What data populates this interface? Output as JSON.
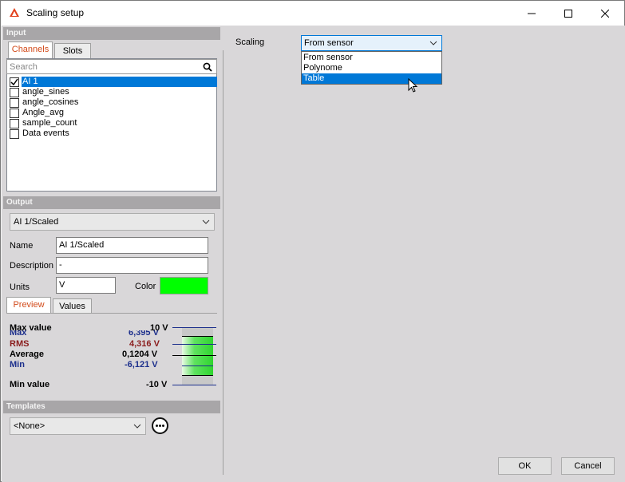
{
  "window": {
    "title": "Scaling setup"
  },
  "input": {
    "header": "Input",
    "tabs": [
      {
        "label": "Channels"
      },
      {
        "label": "Slots"
      }
    ],
    "search_placeholder": "Search",
    "channels": [
      {
        "label": "AI 1",
        "checked": true,
        "selected": true
      },
      {
        "label": "angle_sines",
        "checked": false,
        "selected": false
      },
      {
        "label": "angle_cosines",
        "checked": false,
        "selected": false
      },
      {
        "label": "Angle_avg",
        "checked": false,
        "selected": false
      },
      {
        "label": "sample_count",
        "checked": false,
        "selected": false
      },
      {
        "label": "Data events",
        "checked": false,
        "selected": false
      }
    ]
  },
  "output": {
    "header": "Output",
    "selected_channel": "AI 1/Scaled",
    "name_label": "Name",
    "name_value": "AI 1/Scaled",
    "description_label": "Description",
    "description_value": "-",
    "units_label": "Units",
    "units_value": "V",
    "color_label": "Color",
    "color_value": "#00ff00",
    "tabs": [
      {
        "label": "Preview"
      },
      {
        "label": "Values"
      }
    ],
    "preview": {
      "max_value_label": "Max value",
      "max_value": "10 V",
      "max_label": "Max",
      "max": "6,395 V",
      "rms_label": "RMS",
      "rms": "4,316 V",
      "average_label": "Average",
      "average": "0,1204 V",
      "min_label": "Min",
      "min": "-6,121 V",
      "min_value_label": "Min value",
      "min_value": "-10 V"
    }
  },
  "templates": {
    "header": "Templates",
    "selected": "<None>"
  },
  "scaling": {
    "label": "Scaling",
    "selected": "From sensor",
    "options": [
      {
        "label": "From sensor",
        "highlighted": false
      },
      {
        "label": "Polynome",
        "highlighted": false
      },
      {
        "label": "Table",
        "highlighted": true
      }
    ]
  },
  "buttons": {
    "ok": "OK",
    "cancel": "Cancel"
  },
  "colors": {
    "accent": "#0078d7",
    "tab_active_text": "#d24a1a",
    "section_header": "#a8a6a8"
  }
}
